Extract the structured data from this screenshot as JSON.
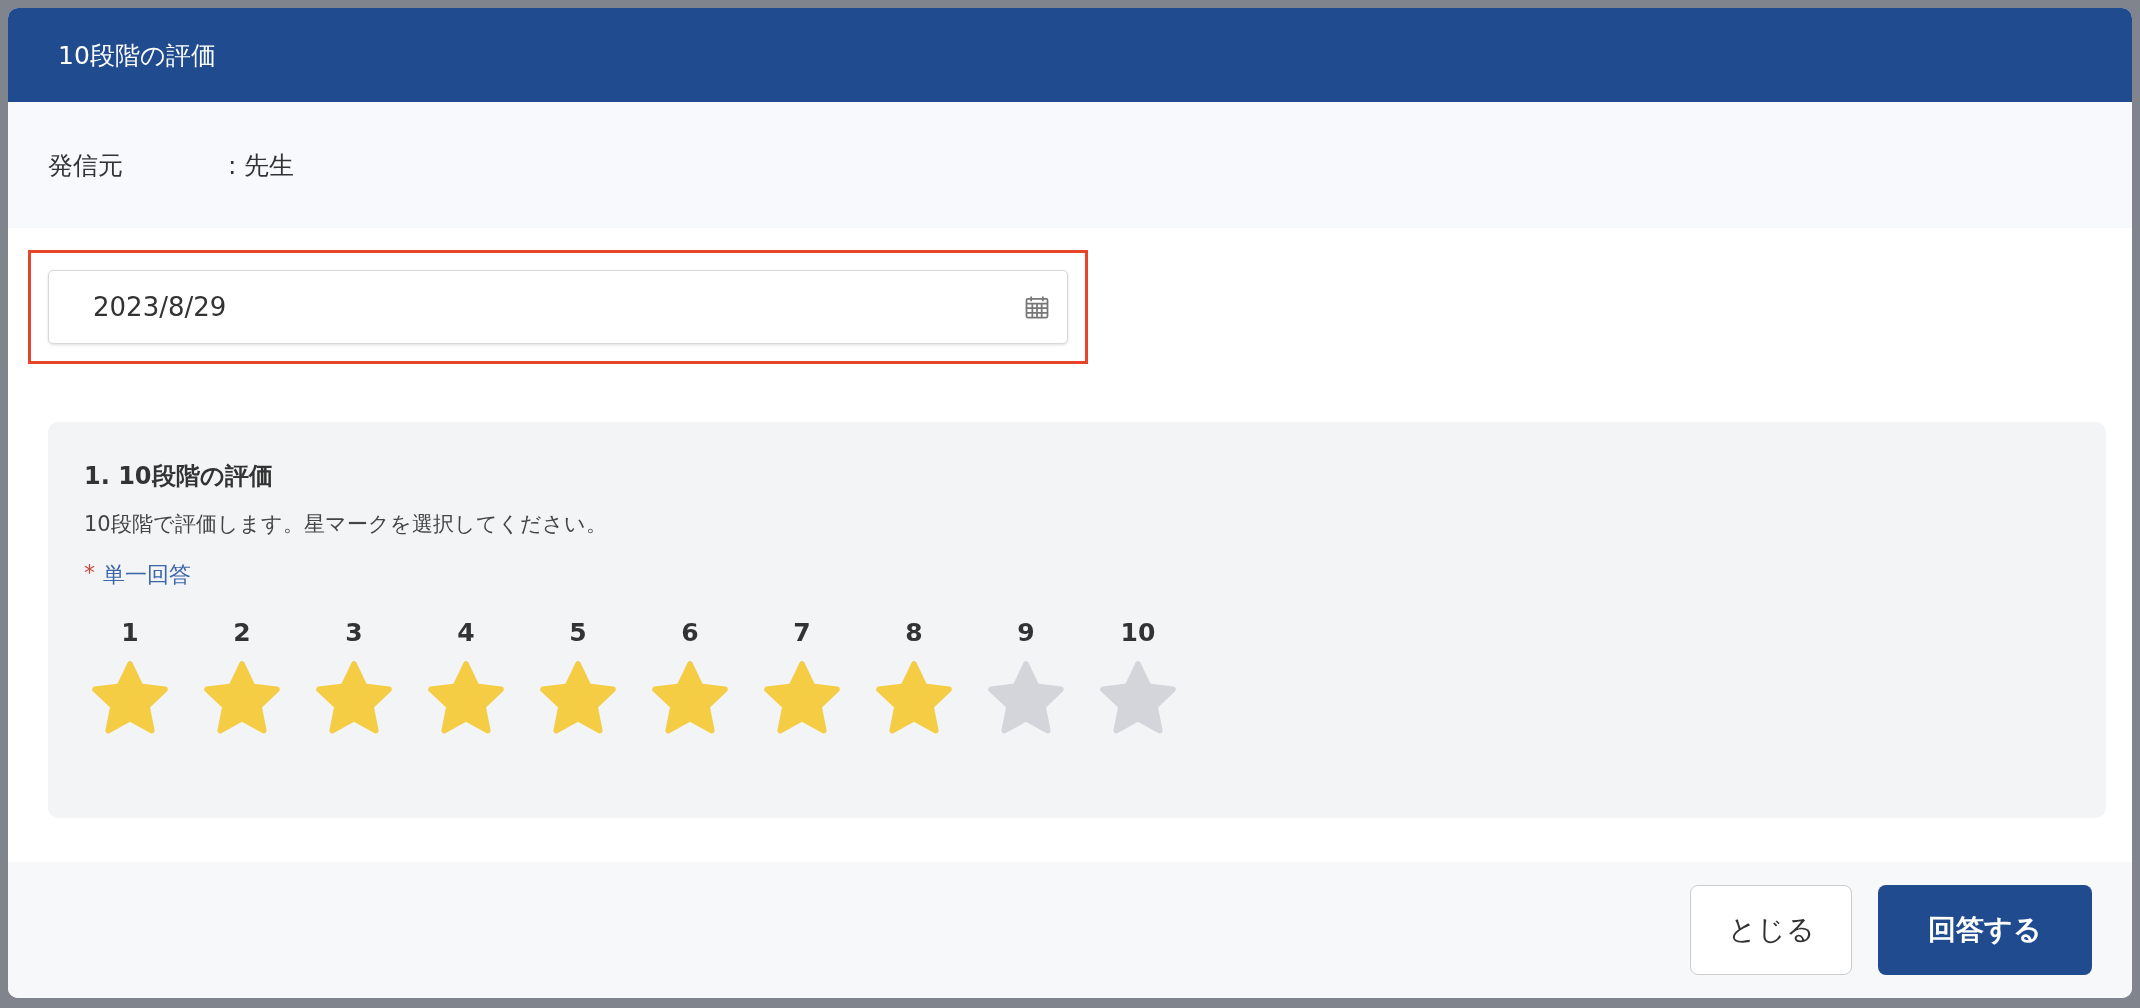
{
  "dialog": {
    "title": "10段階の評価"
  },
  "sender": {
    "label": "発信元",
    "value": ": 先生"
  },
  "date_field": {
    "value": "2023/8/29",
    "highlighted": true
  },
  "question": {
    "title": "1. 10段階の評価",
    "description": "10段階で評価します。星マークを選択してください。",
    "required_mark": "*",
    "answer_type": "単一回答",
    "scale": [
      "1",
      "2",
      "3",
      "4",
      "5",
      "6",
      "7",
      "8",
      "9",
      "10"
    ],
    "stars": 8
  },
  "buttons": [
    {
      "label": "とじる",
      "kind": "secondary"
    },
    {
      "label": "回答する",
      "kind": "primary"
    }
  ]
}
